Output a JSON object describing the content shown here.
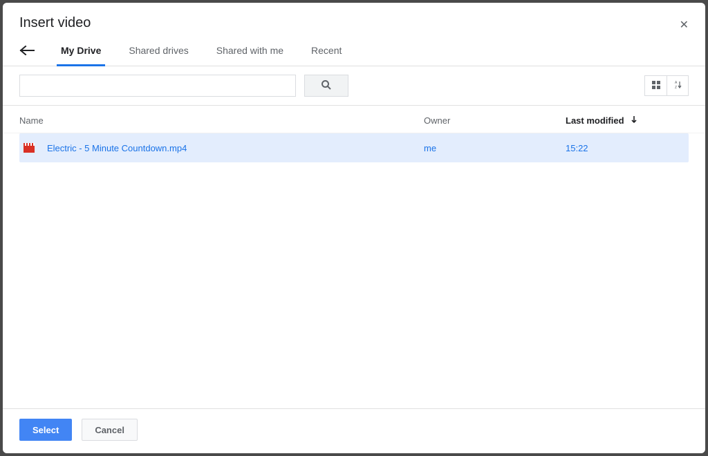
{
  "dialog": {
    "title": "Insert video"
  },
  "tabs": {
    "items": [
      {
        "label": "My Drive",
        "active": true
      },
      {
        "label": "Shared drives"
      },
      {
        "label": "Shared with me"
      },
      {
        "label": "Recent"
      }
    ]
  },
  "search": {
    "value": ""
  },
  "columns": {
    "name": "Name",
    "owner": "Owner",
    "modified": "Last modified"
  },
  "files": [
    {
      "name": "Electric - 5 Minute Countdown.mp4",
      "owner": "me",
      "modified": "15:22",
      "selected": true
    }
  ],
  "footer": {
    "select_label": "Select",
    "cancel_label": "Cancel"
  }
}
